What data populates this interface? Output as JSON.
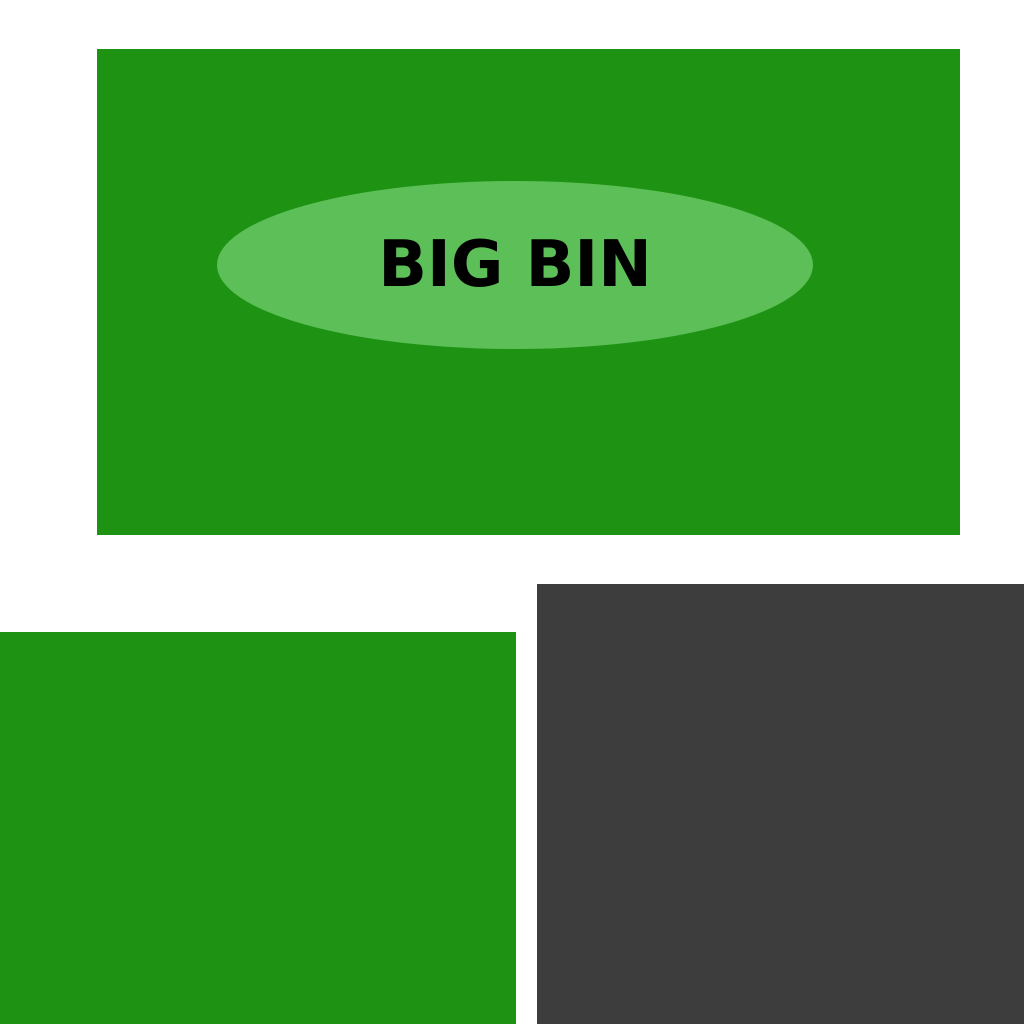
{
  "colors": {
    "background": "#ffffff",
    "bin_green": "#1d9213",
    "label_oval": "#5cbf57",
    "label_text": "#000000",
    "dark_block": "#3d3d3d"
  },
  "big_bin": {
    "label": "BIG BIN"
  }
}
